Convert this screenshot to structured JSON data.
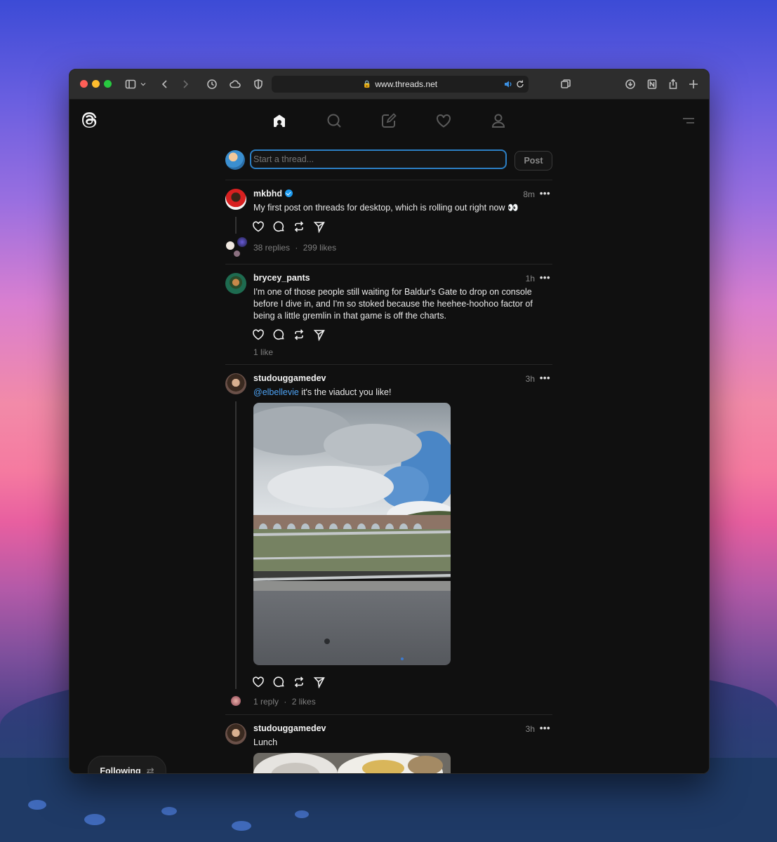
{
  "browser": {
    "url": "www.threads.net"
  },
  "composer": {
    "placeholder": "Start a thread...",
    "post_label": "Post"
  },
  "posts": [
    {
      "username": "mkbhd",
      "verified": true,
      "time": "8m",
      "text": "My first post on threads for desktop, which is rolling out right now 👀",
      "replies": "38 replies",
      "likes": "299 likes"
    },
    {
      "username": "brycey_pants",
      "verified": false,
      "time": "1h",
      "text": "I'm one of those people still waiting for Baldur's Gate to drop on console before I dive in, and I'm so stoked because the heehee-hoohoo factor of being a little gremlin in that game is off the charts.",
      "likes": "1 like"
    },
    {
      "username": "studouggamedev",
      "verified": false,
      "time": "3h",
      "mention": "@elbellevie",
      "text": " it's the viaduct you like!",
      "replies": "1 reply",
      "likes": "2 likes"
    },
    {
      "username": "studouggamedev",
      "verified": false,
      "time": "3h",
      "text": "Lunch"
    }
  ],
  "stat_separator": "·",
  "more_glyph": "•••",
  "following": {
    "label": "Following",
    "icon": "⇄"
  },
  "colors": {
    "accent_blue": "#2c7fc4",
    "mention": "#4da3f5",
    "background": "#101010"
  }
}
